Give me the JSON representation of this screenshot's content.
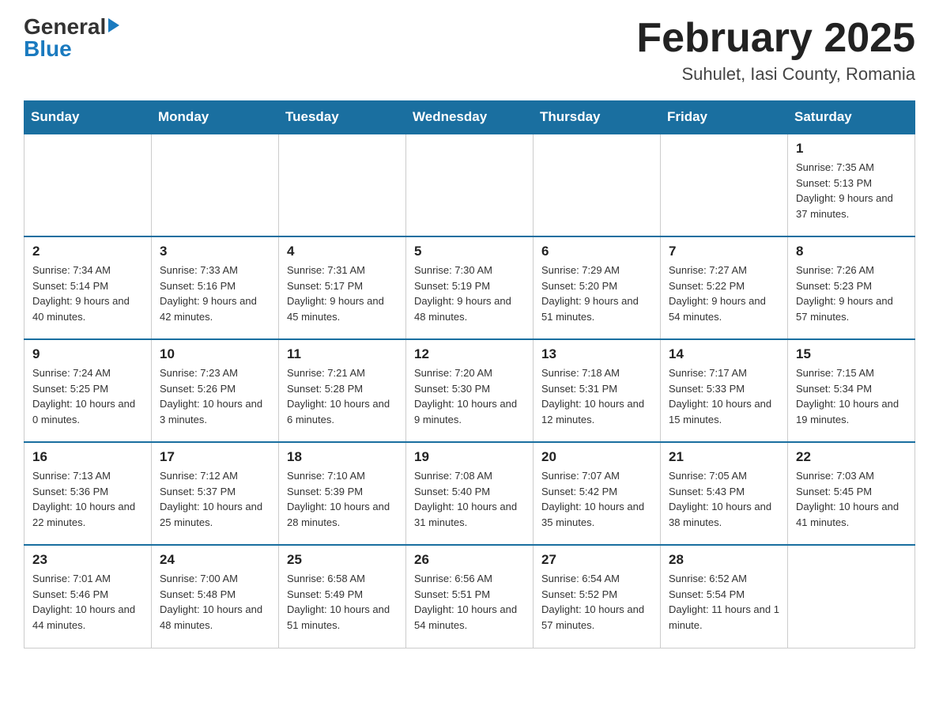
{
  "header": {
    "logo_general": "General",
    "logo_blue": "Blue",
    "month_title": "February 2025",
    "location": "Suhulet, Iasi County, Romania"
  },
  "days_of_week": [
    "Sunday",
    "Monday",
    "Tuesday",
    "Wednesday",
    "Thursday",
    "Friday",
    "Saturday"
  ],
  "weeks": [
    [
      {
        "day": "",
        "info": ""
      },
      {
        "day": "",
        "info": ""
      },
      {
        "day": "",
        "info": ""
      },
      {
        "day": "",
        "info": ""
      },
      {
        "day": "",
        "info": ""
      },
      {
        "day": "",
        "info": ""
      },
      {
        "day": "1",
        "info": "Sunrise: 7:35 AM\nSunset: 5:13 PM\nDaylight: 9 hours and 37 minutes."
      }
    ],
    [
      {
        "day": "2",
        "info": "Sunrise: 7:34 AM\nSunset: 5:14 PM\nDaylight: 9 hours and 40 minutes."
      },
      {
        "day": "3",
        "info": "Sunrise: 7:33 AM\nSunset: 5:16 PM\nDaylight: 9 hours and 42 minutes."
      },
      {
        "day": "4",
        "info": "Sunrise: 7:31 AM\nSunset: 5:17 PM\nDaylight: 9 hours and 45 minutes."
      },
      {
        "day": "5",
        "info": "Sunrise: 7:30 AM\nSunset: 5:19 PM\nDaylight: 9 hours and 48 minutes."
      },
      {
        "day": "6",
        "info": "Sunrise: 7:29 AM\nSunset: 5:20 PM\nDaylight: 9 hours and 51 minutes."
      },
      {
        "day": "7",
        "info": "Sunrise: 7:27 AM\nSunset: 5:22 PM\nDaylight: 9 hours and 54 minutes."
      },
      {
        "day": "8",
        "info": "Sunrise: 7:26 AM\nSunset: 5:23 PM\nDaylight: 9 hours and 57 minutes."
      }
    ],
    [
      {
        "day": "9",
        "info": "Sunrise: 7:24 AM\nSunset: 5:25 PM\nDaylight: 10 hours and 0 minutes."
      },
      {
        "day": "10",
        "info": "Sunrise: 7:23 AM\nSunset: 5:26 PM\nDaylight: 10 hours and 3 minutes."
      },
      {
        "day": "11",
        "info": "Sunrise: 7:21 AM\nSunset: 5:28 PM\nDaylight: 10 hours and 6 minutes."
      },
      {
        "day": "12",
        "info": "Sunrise: 7:20 AM\nSunset: 5:30 PM\nDaylight: 10 hours and 9 minutes."
      },
      {
        "day": "13",
        "info": "Sunrise: 7:18 AM\nSunset: 5:31 PM\nDaylight: 10 hours and 12 minutes."
      },
      {
        "day": "14",
        "info": "Sunrise: 7:17 AM\nSunset: 5:33 PM\nDaylight: 10 hours and 15 minutes."
      },
      {
        "day": "15",
        "info": "Sunrise: 7:15 AM\nSunset: 5:34 PM\nDaylight: 10 hours and 19 minutes."
      }
    ],
    [
      {
        "day": "16",
        "info": "Sunrise: 7:13 AM\nSunset: 5:36 PM\nDaylight: 10 hours and 22 minutes."
      },
      {
        "day": "17",
        "info": "Sunrise: 7:12 AM\nSunset: 5:37 PM\nDaylight: 10 hours and 25 minutes."
      },
      {
        "day": "18",
        "info": "Sunrise: 7:10 AM\nSunset: 5:39 PM\nDaylight: 10 hours and 28 minutes."
      },
      {
        "day": "19",
        "info": "Sunrise: 7:08 AM\nSunset: 5:40 PM\nDaylight: 10 hours and 31 minutes."
      },
      {
        "day": "20",
        "info": "Sunrise: 7:07 AM\nSunset: 5:42 PM\nDaylight: 10 hours and 35 minutes."
      },
      {
        "day": "21",
        "info": "Sunrise: 7:05 AM\nSunset: 5:43 PM\nDaylight: 10 hours and 38 minutes."
      },
      {
        "day": "22",
        "info": "Sunrise: 7:03 AM\nSunset: 5:45 PM\nDaylight: 10 hours and 41 minutes."
      }
    ],
    [
      {
        "day": "23",
        "info": "Sunrise: 7:01 AM\nSunset: 5:46 PM\nDaylight: 10 hours and 44 minutes."
      },
      {
        "day": "24",
        "info": "Sunrise: 7:00 AM\nSunset: 5:48 PM\nDaylight: 10 hours and 48 minutes."
      },
      {
        "day": "25",
        "info": "Sunrise: 6:58 AM\nSunset: 5:49 PM\nDaylight: 10 hours and 51 minutes."
      },
      {
        "day": "26",
        "info": "Sunrise: 6:56 AM\nSunset: 5:51 PM\nDaylight: 10 hours and 54 minutes."
      },
      {
        "day": "27",
        "info": "Sunrise: 6:54 AM\nSunset: 5:52 PM\nDaylight: 10 hours and 57 minutes."
      },
      {
        "day": "28",
        "info": "Sunrise: 6:52 AM\nSunset: 5:54 PM\nDaylight: 11 hours and 1 minute."
      },
      {
        "day": "",
        "info": ""
      }
    ]
  ]
}
